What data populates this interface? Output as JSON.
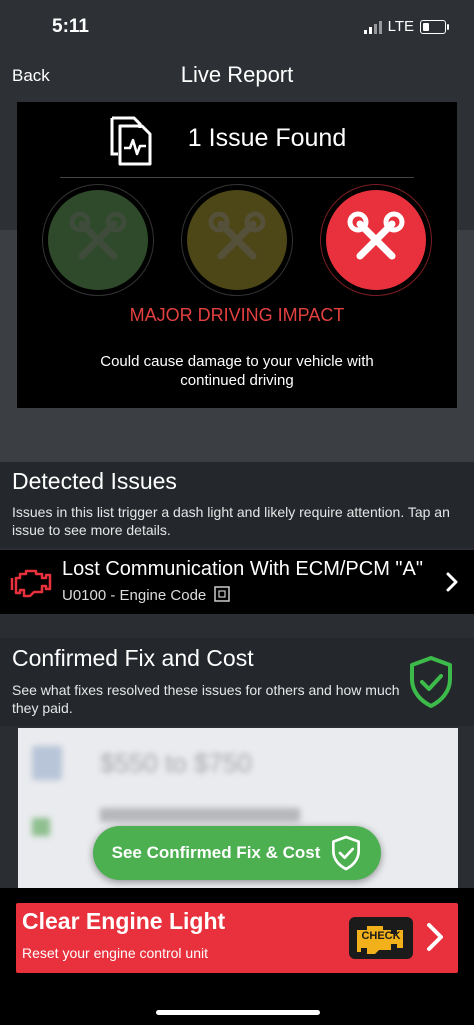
{
  "status_bar": {
    "time": "5:11",
    "network": "LTE"
  },
  "nav": {
    "back_label": "Back",
    "title": "Live Report"
  },
  "report": {
    "issues_found": "1 Issue Found",
    "impact_level": "MAJOR DRIVING IMPACT",
    "impact_description": "Could cause damage to your vehicle with continued driving",
    "indicators": [
      {
        "name": "minor",
        "color": "#2f4a2a",
        "active": false
      },
      {
        "name": "moderate",
        "color": "#4d4616",
        "active": false
      },
      {
        "name": "major",
        "color": "#e8313c",
        "active": true
      }
    ]
  },
  "detected_issues": {
    "title": "Detected Issues",
    "description": "Issues in this list trigger a dash light and likely require attention. Tap an issue to see more details.",
    "items": [
      {
        "title": "Lost Communication With ECM/PCM \"A\"",
        "code": "U0100 - Engine Code"
      }
    ]
  },
  "confirmed_fix": {
    "title": "Confirmed Fix and Cost",
    "description": "See what fixes resolved these issues for others and how much they paid.",
    "blurred_price": "$550 to $750",
    "button_label": "See Confirmed Fix & Cost"
  },
  "clear_light": {
    "title": "Clear Engine Light",
    "description": "Reset your engine control unit",
    "badge": "CHECK"
  },
  "colors": {
    "accent_red": "#e8313c",
    "accent_green": "#4caf50",
    "shield_green": "#3dbb4a"
  }
}
